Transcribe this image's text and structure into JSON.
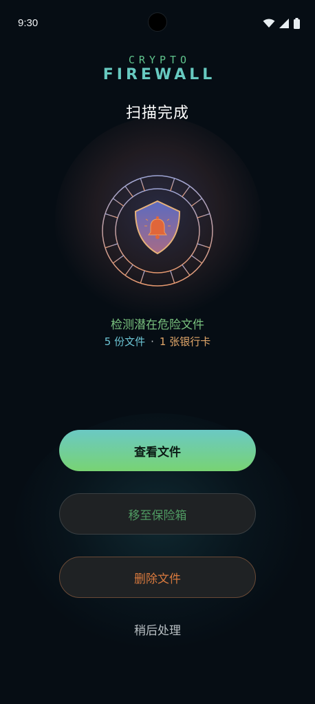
{
  "status_bar": {
    "time": "9:30",
    "icons": [
      "wifi-icon",
      "cellular-signal-icon",
      "battery-icon"
    ]
  },
  "brand": {
    "line1": "CRYPTO",
    "line2": "FIREWALL"
  },
  "title": "扫描完成",
  "emblem": {
    "icon": "shield-bell-icon"
  },
  "detection": {
    "title": "检测潜在危险文件",
    "files": "5 份文件",
    "separator": "·",
    "cards": "1 张银行卡"
  },
  "actions": {
    "view_label": "查看文件",
    "vault_label": "移至保险箱",
    "delete_label": "删除文件",
    "later_label": "稍后处理"
  },
  "colors": {
    "background": "#060d14",
    "accent_green": "#79c27e",
    "accent_cyan": "#6dc6d6",
    "accent_orange": "#e3a86a",
    "danger": "#d97a3e"
  }
}
